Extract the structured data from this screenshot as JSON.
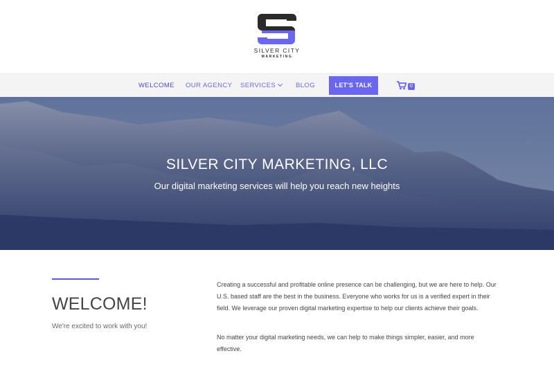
{
  "brand": {
    "logo_text": "SILVER CITY",
    "logo_subtext": "MARKETING",
    "accent_color": "#6b66f2",
    "logo_dark_color": "#2b2b2b"
  },
  "nav": {
    "items": [
      {
        "label": "WELCOME"
      },
      {
        "label": "OUR AGENCY"
      },
      {
        "label": "SERVICES"
      },
      {
        "label": "BLOG"
      }
    ],
    "cta_label": "LET'S TALK",
    "cart_icon": "cart-icon",
    "cart_count": "0"
  },
  "hero": {
    "title": "SILVER CITY MARKETING, LLC",
    "subtitle": "Our digital marketing services will help you reach new heights"
  },
  "welcome": {
    "title": "WELCOME!",
    "subtitle": "We're excited to work with you!",
    "paragraph_1": "Creating a successful and profitable online presence can be challenging, but we are here to help. Our U.S. based staff are the best in the business. Everyone who works for us is a verified expert in their field. We leverage our proven digital marketing expertise to help our clients achieve their goals.",
    "paragraph_2": "No matter your digital marketing needs, we can help to make things simpler, easier, and more effective."
  }
}
